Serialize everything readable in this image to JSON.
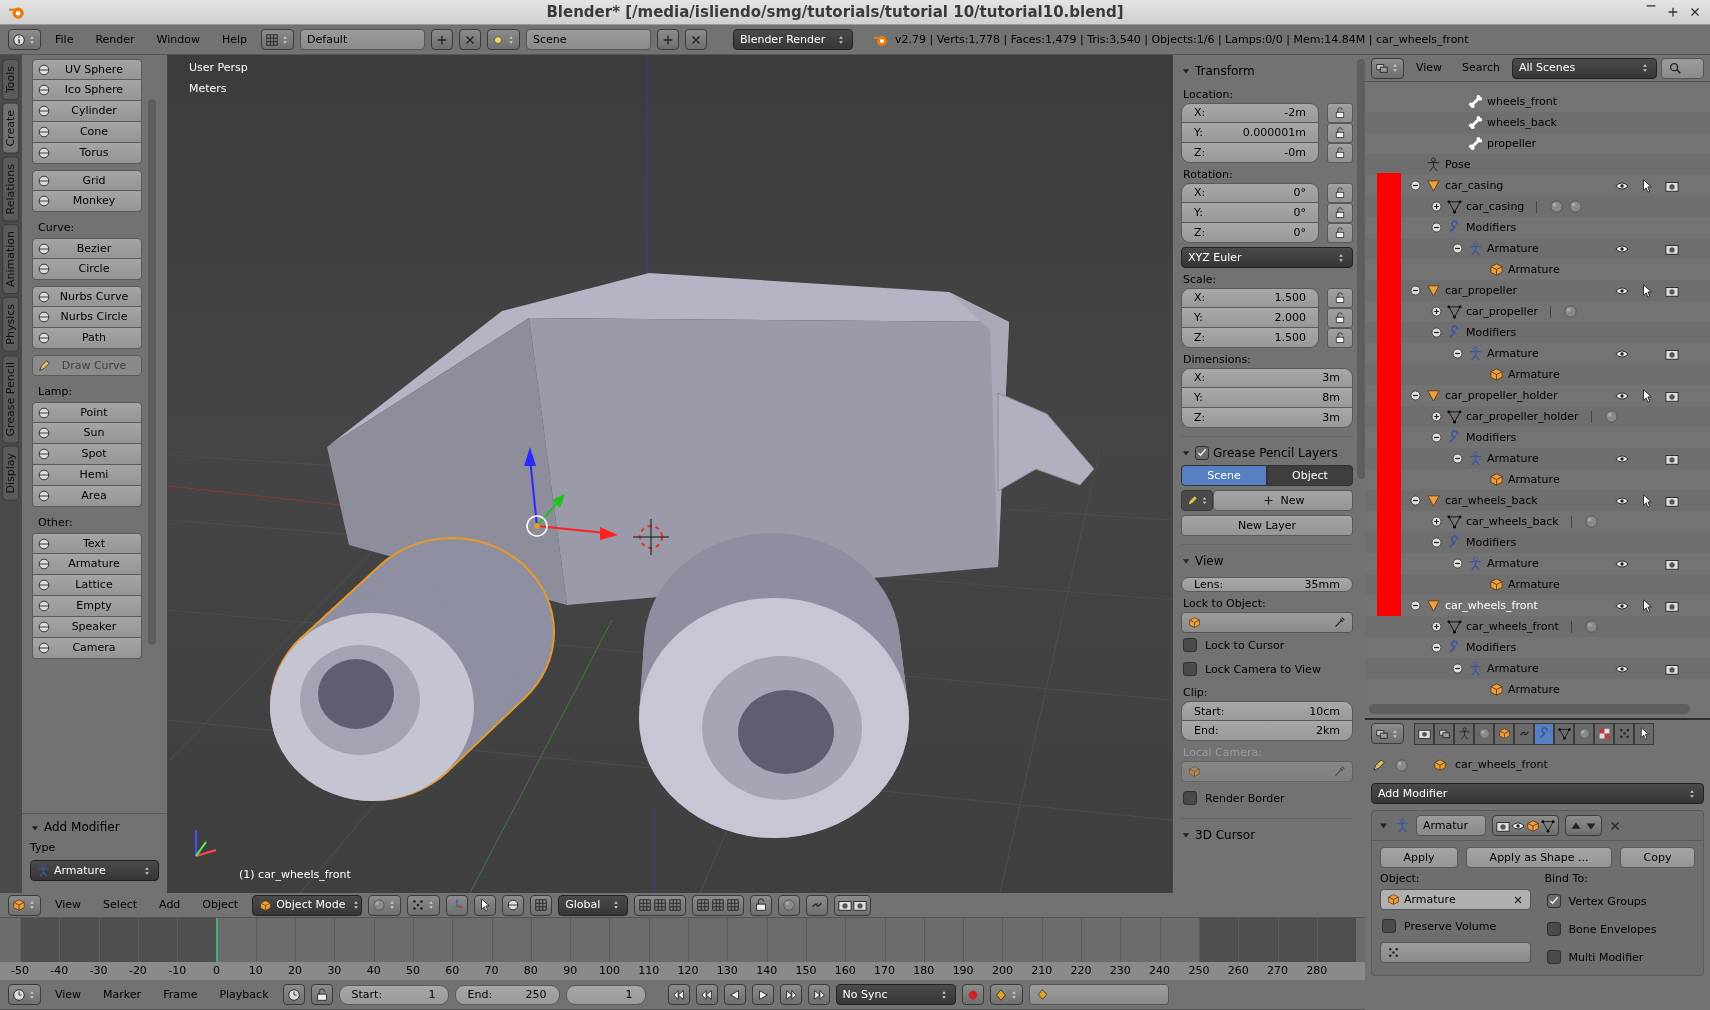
{
  "window": {
    "title": "Blender* [/media/isliendo/smg/tutorials/tutorial 10/tutorial10.blend]"
  },
  "info_header": {
    "menus": [
      "File",
      "Render",
      "Window",
      "Help"
    ],
    "layout": "Default",
    "scene": "Scene",
    "engine": "Blender Render",
    "stats": "v2.79 | Verts:1,778 | Faces:1,479 | Tris:3,540 | Objects:1/6 | Lamps:0/0 | Mem:14.84M | car_wheels_front"
  },
  "tool_shelf": {
    "tabs": [
      {
        "label": "Tools",
        "selected": false
      },
      {
        "label": "Create",
        "selected": true
      },
      {
        "label": "Relations",
        "selected": false
      },
      {
        "label": "Animation",
        "selected": false
      },
      {
        "label": "Physics",
        "selected": false
      },
      {
        "label": "Grease Pencil",
        "selected": false
      },
      {
        "label": "Display",
        "selected": false
      }
    ],
    "sections": [
      {
        "buttons": [
          {
            "label": "UV Sphere",
            "disabled": false
          },
          {
            "label": "Ico Sphere",
            "disabled": false
          },
          {
            "label": "Cylinder",
            "disabled": false
          },
          {
            "label": "Cone",
            "disabled": false
          },
          {
            "label": "Torus",
            "disabled": false
          }
        ]
      },
      {
        "buttons": [
          {
            "label": "Grid",
            "disabled": false
          },
          {
            "label": "Monkey",
            "disabled": false
          }
        ]
      },
      {
        "heading": "Curve:",
        "buttons": [
          {
            "label": "Bezier",
            "disabled": false
          },
          {
            "label": "Circle",
            "disabled": false
          }
        ]
      },
      {
        "buttons": [
          {
            "label": "Nurbs Curve",
            "disabled": false
          },
          {
            "label": "Nurbs Circle",
            "disabled": false
          },
          {
            "label": "Path",
            "disabled": false
          }
        ]
      },
      {
        "buttons": [
          {
            "label": "Draw Curve",
            "disabled": true
          }
        ]
      },
      {
        "heading": "Lamp:",
        "buttons": [
          {
            "label": "Point",
            "disabled": false
          },
          {
            "label": "Sun",
            "disabled": false
          },
          {
            "label": "Spot",
            "disabled": false
          },
          {
            "label": "Hemi",
            "disabled": false
          },
          {
            "label": "Area",
            "disabled": false
          }
        ]
      },
      {
        "heading": "Other:",
        "buttons": [
          {
            "label": "Text",
            "disabled": false
          },
          {
            "label": "Armature",
            "disabled": false
          },
          {
            "label": "Lattice",
            "disabled": false
          },
          {
            "label": "Empty",
            "disabled": false
          },
          {
            "label": "Speaker",
            "disabled": false
          },
          {
            "label": "Camera",
            "disabled": false
          }
        ]
      }
    ],
    "operator_panel": {
      "title": "Add Modifier",
      "field_label": "Type",
      "value": "Armature"
    }
  },
  "viewport": {
    "view_name": "User Persp",
    "units": "Meters",
    "object_label": "(1) car_wheels_front"
  },
  "n_panel": {
    "transform": {
      "title": "Transform",
      "groups": [
        {
          "label": "Location:",
          "lockable": true,
          "fields": [
            {
              "axis": "X:",
              "value": "-2m"
            },
            {
              "axis": "Y:",
              "value": "0.000001m"
            },
            {
              "axis": "Z:",
              "value": "-0m"
            }
          ]
        },
        {
          "label": "Rotation:",
          "lockable": true,
          "fields": [
            {
              "axis": "X:",
              "value": "0°"
            },
            {
              "axis": "Y:",
              "value": "0°"
            },
            {
              "axis": "Z:",
              "value": "0°"
            }
          ],
          "mode": "XYZ Euler"
        },
        {
          "label": "Scale:",
          "lockable": true,
          "fields": [
            {
              "axis": "X:",
              "value": "1.500"
            },
            {
              "axis": "Y:",
              "value": "2.000"
            },
            {
              "axis": "Z:",
              "value": "1.500"
            }
          ]
        },
        {
          "label": "Dimensions:",
          "lockable": false,
          "fields": [
            {
              "axis": "X:",
              "value": "3m"
            },
            {
              "axis": "Y:",
              "value": "8m"
            },
            {
              "axis": "Z:",
              "value": "3m"
            }
          ]
        }
      ]
    },
    "grease_pencil": {
      "title": "Grease Pencil Layers",
      "enabled": true,
      "sources": [
        {
          "label": "Scene",
          "selected": true
        },
        {
          "label": "Object",
          "selected": false
        }
      ],
      "new_label": "New",
      "new_layer": "New Layer"
    },
    "view": {
      "title": "View",
      "lens": {
        "label": "Lens:",
        "value": "35mm"
      },
      "lock_object_label": "Lock to Object:",
      "lock_to_cursor": {
        "label": "Lock to Cursor",
        "checked": false
      },
      "lock_camera": {
        "label": "Lock Camera to View",
        "checked": false
      },
      "clip_label": "Clip:",
      "clip": [
        {
          "label": "Start:",
          "value": "10cm"
        },
        {
          "label": "End:",
          "value": "2km"
        }
      ],
      "local_camera": {
        "label": "Local Camera:",
        "disabled": true
      },
      "render_border": {
        "label": "Render Border",
        "checked": false
      }
    },
    "cursor_panel": {
      "title": "3D Cursor"
    }
  },
  "outliner": {
    "menus": [
      "View",
      "Search"
    ],
    "display_mode": "All Scenes",
    "tree": [
      {
        "children": [
          {
            "children": [
              {
                "kind": "bone",
                "label": "wheels_front"
              },
              {
                "kind": "bone",
                "label": "wheels_back"
              },
              {
                "kind": "bone",
                "label": "propeller"
              }
            ]
          }
        ]
      },
      {
        "kind": "pose",
        "label": "Pose"
      },
      {
        "kind": "object",
        "label": "car_casing",
        "expanded": true,
        "selected": false,
        "children": [
          {
            "kind": "mesh",
            "label": "car_casing",
            "expanded": false,
            "materials": [
              {
                "kind": "material"
              },
              {
                "kind": "material"
              }
            ]
          },
          {
            "kind": "modifiers",
            "label": "Modifiers",
            "expanded": true,
            "children": [
              {
                "kind": "modifier",
                "label": "Armature",
                "expanded": true,
                "children": [
                  {
                    "kind": "armature_object",
                    "label": "Armature"
                  }
                ]
              }
            ]
          }
        ]
      },
      {
        "kind": "object",
        "label": "car_propeller",
        "expanded": true,
        "selected": false,
        "children": [
          {
            "kind": "mesh",
            "label": "car_propeller",
            "expanded": false,
            "materials": [
              {
                "kind": "material"
              }
            ]
          },
          {
            "kind": "modifiers",
            "label": "Modifiers",
            "expanded": true,
            "children": [
              {
                "kind": "modifier",
                "label": "Armature",
                "expanded": true,
                "children": [
                  {
                    "kind": "armature_object",
                    "label": "Armature"
                  }
                ]
              }
            ]
          }
        ]
      },
      {
        "kind": "object",
        "label": "car_propeller_holder",
        "expanded": true,
        "selected": false,
        "children": [
          {
            "kind": "mesh",
            "label": "car_propeller_holder",
            "expanded": false,
            "materials": [
              {
                "kind": "material"
              }
            ]
          },
          {
            "kind": "modifiers",
            "label": "Modifiers",
            "expanded": true,
            "children": [
              {
                "kind": "modifier",
                "label": "Armature",
                "expanded": true,
                "children": [
                  {
                    "kind": "armature_object",
                    "label": "Armature"
                  }
                ]
              }
            ]
          }
        ]
      },
      {
        "kind": "object",
        "label": "car_wheels_back",
        "expanded": true,
        "selected": false,
        "children": [
          {
            "kind": "mesh",
            "label": "car_wheels_back",
            "expanded": false,
            "materials": [
              {
                "kind": "material"
              }
            ]
          },
          {
            "kind": "modifiers",
            "label": "Modifiers",
            "expanded": true,
            "children": [
              {
                "kind": "modifier",
                "label": "Armature",
                "expanded": true,
                "children": [
                  {
                    "kind": "armature_object",
                    "label": "Armature"
                  }
                ]
              }
            ]
          }
        ]
      },
      {
        "kind": "object",
        "label": "car_wheels_front",
        "expanded": true,
        "selected": true,
        "children": [
          {
            "kind": "mesh",
            "label": "car_wheels_front",
            "expanded": false,
            "materials": [
              {
                "kind": "material"
              }
            ]
          },
          {
            "kind": "modifiers",
            "label": "Modifiers",
            "expanded": true,
            "children": [
              {
                "kind": "modifier",
                "label": "Armature",
                "expanded": true,
                "children": [
                  {
                    "kind": "armature_object",
                    "label": "Armature"
                  }
                ]
              }
            ]
          }
        ]
      }
    ]
  },
  "properties": {
    "tabs": [
      {
        "selected": false
      },
      {
        "selected": false
      },
      {
        "selected": false
      },
      {
        "selected": false
      },
      {
        "selected": false
      },
      {
        "selected": false
      },
      {
        "selected": true
      },
      {
        "selected": false
      },
      {
        "selected": false
      },
      {
        "selected": false
      },
      {
        "selected": false
      },
      {
        "selected": false
      }
    ],
    "context": "car_wheels_front",
    "add_modifier": "Add Modifier",
    "modifier": {
      "name": "Armatur",
      "expanded": true,
      "buttons": [
        "Apply",
        "Apply as Shape ...",
        "Copy"
      ],
      "object_label": "Object:",
      "object": "Armature",
      "left_options": [
        {
          "label": "Preserve Volume",
          "checked": false
        }
      ],
      "bind_label": "Bind To:",
      "bind_options": [
        {
          "label": "Vertex Groups",
          "checked": true
        },
        {
          "label": "Bone Envelopes",
          "checked": false
        },
        {
          "label": "Multi Modifier",
          "checked": false
        }
      ]
    }
  },
  "viewport_header": {
    "menus": [
      "View",
      "Select",
      "Add",
      "Object"
    ],
    "mode": "Object Mode",
    "orientation": "Global"
  },
  "timeline": {
    "ticks": [
      {
        "label": "-50",
        "in_range": false,
        "current": false
      },
      {
        "label": "-40",
        "in_range": false,
        "current": false
      },
      {
        "label": "-30",
        "in_range": false,
        "current": false
      },
      {
        "label": "-20",
        "in_range": false,
        "current": false
      },
      {
        "label": "-10",
        "in_range": false,
        "current": false
      },
      {
        "label": "0",
        "in_range": true,
        "current": true
      },
      {
        "label": "10",
        "in_range": true,
        "current": false
      },
      {
        "label": "20",
        "in_range": true,
        "current": false
      },
      {
        "label": "30",
        "in_range": true,
        "current": false
      },
      {
        "label": "40",
        "in_range": true,
        "current": false
      },
      {
        "label": "50",
        "in_range": true,
        "current": false
      },
      {
        "label": "60",
        "in_range": true,
        "current": false
      },
      {
        "label": "70",
        "in_range": true,
        "current": false
      },
      {
        "label": "80",
        "in_range": true,
        "current": false
      },
      {
        "label": "90",
        "in_range": true,
        "current": false
      },
      {
        "label": "100",
        "in_range": true,
        "current": false
      },
      {
        "label": "110",
        "in_range": true,
        "current": false
      },
      {
        "label": "120",
        "in_range": true,
        "current": false
      },
      {
        "label": "130",
        "in_range": true,
        "current": false
      },
      {
        "label": "140",
        "in_range": true,
        "current": false
      },
      {
        "label": "150",
        "in_range": true,
        "current": false
      },
      {
        "label": "160",
        "in_range": true,
        "current": false
      },
      {
        "label": "170",
        "in_range": true,
        "current": false
      },
      {
        "label": "180",
        "in_range": true,
        "current": false
      },
      {
        "label": "190",
        "in_range": true,
        "current": false
      },
      {
        "label": "200",
        "in_range": true,
        "current": false
      },
      {
        "label": "210",
        "in_range": true,
        "current": false
      },
      {
        "label": "220",
        "in_range": true,
        "current": false
      },
      {
        "label": "230",
        "in_range": true,
        "current": false
      },
      {
        "label": "240",
        "in_range": true,
        "current": false
      },
      {
        "label": "250",
        "in_range": false,
        "current": false
      },
      {
        "label": "260",
        "in_range": false,
        "current": false
      },
      {
        "label": "270",
        "in_range": false,
        "current": false
      },
      {
        "label": "280",
        "in_range": false,
        "current": false
      }
    ],
    "menus": [
      "View",
      "Marker",
      "Frame",
      "Playback"
    ],
    "start": {
      "label": "Start:",
      "value": "1"
    },
    "end": {
      "label": "End:",
      "value": "250"
    },
    "current": "1",
    "sync": "No Sync"
  }
}
